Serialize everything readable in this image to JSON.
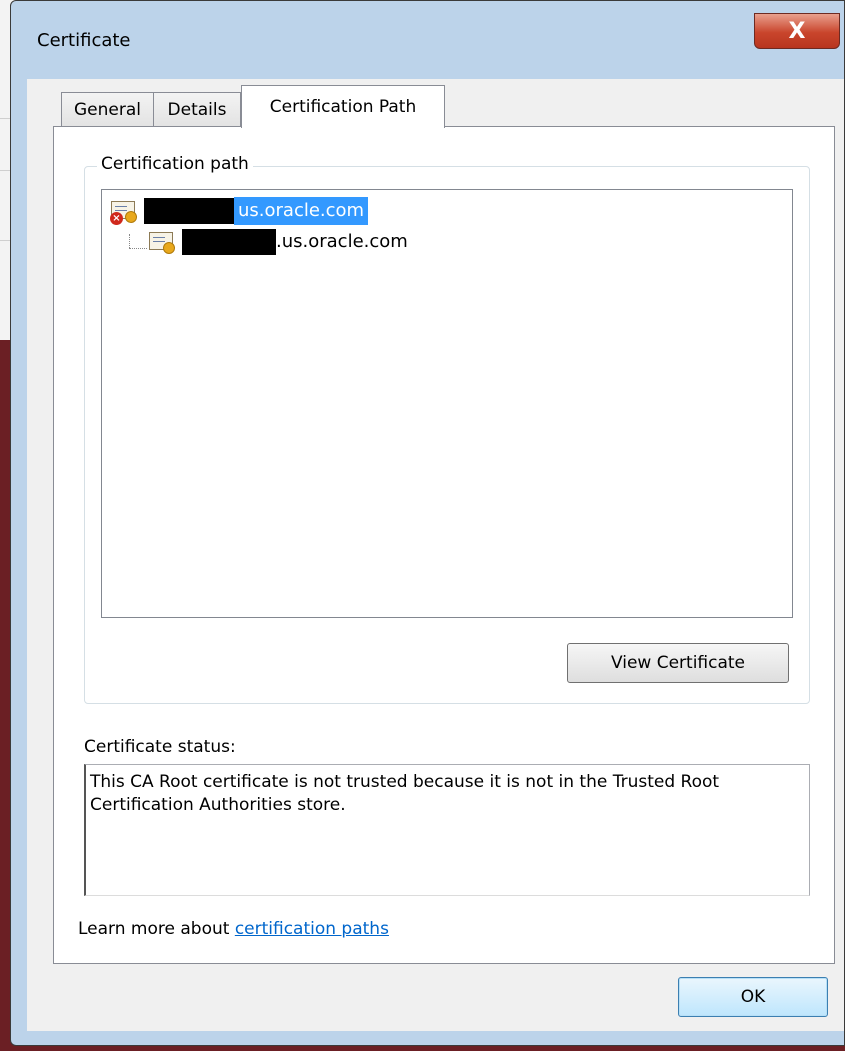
{
  "window": {
    "title": "Certificate",
    "close_glyph": "X"
  },
  "tabs": [
    {
      "label": "General",
      "active": false
    },
    {
      "label": "Details",
      "active": false
    },
    {
      "label": "Certification Path",
      "active": true
    }
  ],
  "certification_path": {
    "label": "Certification path",
    "nodes": [
      {
        "text": "us.oracle.com",
        "level": 0,
        "selected": true,
        "error": true,
        "icon": "certificate-error-icon"
      },
      {
        "text": ".us.oracle.com",
        "level": 1,
        "selected": false,
        "error": false,
        "icon": "certificate-icon"
      }
    ],
    "view_certificate_label": "View Certificate"
  },
  "status": {
    "label": "Certificate status:",
    "text": "This CA Root certificate is not trusted because it is not in the Trusted Root Certification Authorities store."
  },
  "learn_more": {
    "prefix": "Learn more about ",
    "link": "certification paths"
  },
  "ok_label": "OK",
  "colors": {
    "selection": "#3399ff",
    "link": "#0066cc",
    "close_button": "#c9452c"
  }
}
